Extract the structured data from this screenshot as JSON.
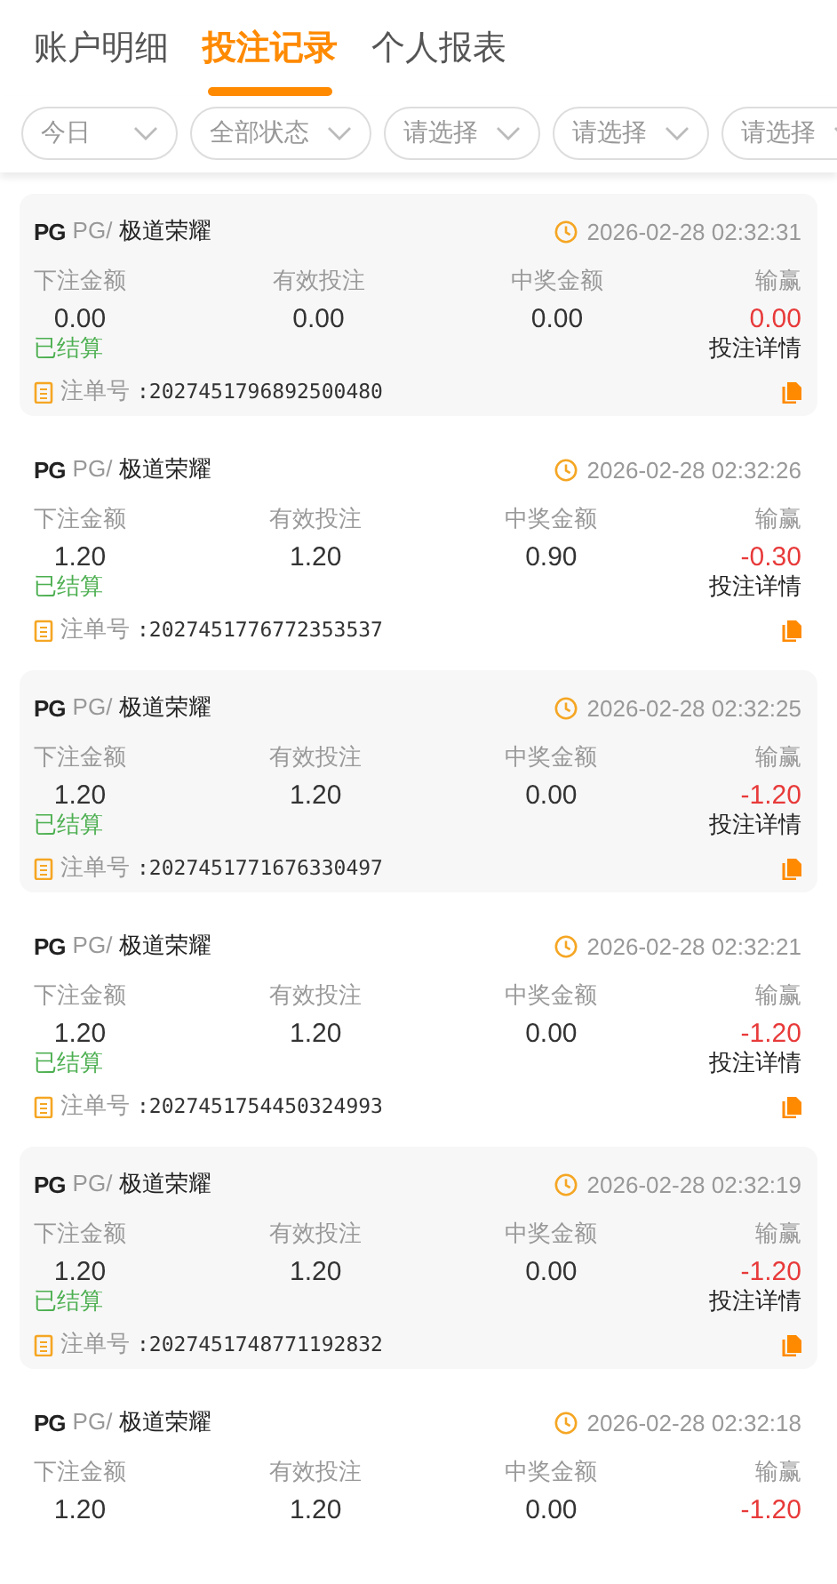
{
  "tabs": [
    {
      "label": "账户明细",
      "selected": false
    },
    {
      "label": "投注记录",
      "selected": true
    },
    {
      "label": "个人报表",
      "selected": false
    }
  ],
  "filters": [
    {
      "label": "今日"
    },
    {
      "label": "全部状态"
    },
    {
      "label": "请选择"
    },
    {
      "label": "请选择"
    },
    {
      "label": "请选择"
    }
  ],
  "bets": [
    {
      "logo": "PG",
      "provider": "PG/",
      "game": "极道荣耀",
      "time": "2026-02-28 02:32:31",
      "labels": [
        "下注金额",
        "有效投注",
        "中奖金额",
        "输赢"
      ],
      "values": [
        "0.00",
        "0.00",
        "0.00",
        "0.00"
      ],
      "status": "已结算",
      "details": "投注详情",
      "order_label": "注单号",
      "order_no": ":2027451796892500480"
    },
    {
      "logo": "PG",
      "provider": "PG/",
      "game": "极道荣耀",
      "time": "2026-02-28 02:32:26",
      "labels": [
        "下注金额",
        "有效投注",
        "中奖金额",
        "输赢"
      ],
      "values": [
        "1.20",
        "1.20",
        "0.90",
        "-0.30"
      ],
      "status": "已结算",
      "details": "投注详情",
      "order_label": "注单号",
      "order_no": ":2027451776772353537"
    },
    {
      "logo": "PG",
      "provider": "PG/",
      "game": "极道荣耀",
      "time": "2026-02-28 02:32:25",
      "labels": [
        "下注金额",
        "有效投注",
        "中奖金额",
        "输赢"
      ],
      "values": [
        "1.20",
        "1.20",
        "0.00",
        "-1.20"
      ],
      "status": "已结算",
      "details": "投注详情",
      "order_label": "注单号",
      "order_no": ":2027451771676330497"
    },
    {
      "logo": "PG",
      "provider": "PG/",
      "game": "极道荣耀",
      "time": "2026-02-28 02:32:21",
      "labels": [
        "下注金额",
        "有效投注",
        "中奖金额",
        "输赢"
      ],
      "values": [
        "1.20",
        "1.20",
        "0.00",
        "-1.20"
      ],
      "status": "已结算",
      "details": "投注详情",
      "order_label": "注单号",
      "order_no": ":2027451754450324993"
    },
    {
      "logo": "PG",
      "provider": "PG/",
      "game": "极道荣耀",
      "time": "2026-02-28 02:32:19",
      "labels": [
        "下注金额",
        "有效投注",
        "中奖金额",
        "输赢"
      ],
      "values": [
        "1.20",
        "1.20",
        "0.00",
        "-1.20"
      ],
      "status": "已结算",
      "details": "投注详情",
      "order_label": "注单号",
      "order_no": ":2027451748771192832"
    },
    {
      "logo": "PG",
      "provider": "PG/",
      "game": "极道荣耀",
      "time": "2026-02-28 02:32:18",
      "labels": [
        "下注金额",
        "有效投注",
        "中奖金额",
        "输赢"
      ],
      "values": [
        "1.20",
        "1.20",
        "0.00",
        "-1.20"
      ]
    }
  ]
}
